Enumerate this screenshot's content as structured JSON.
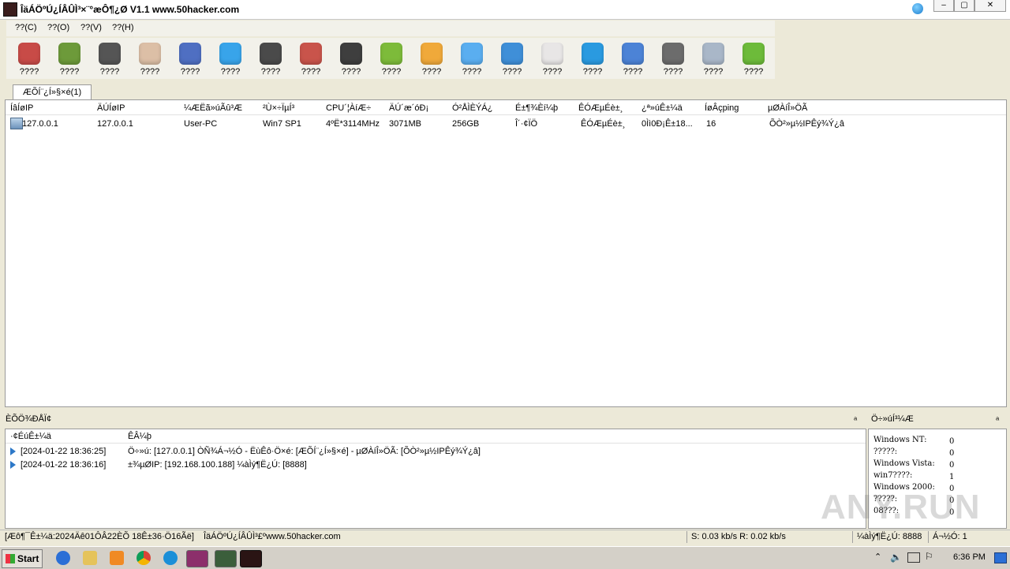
{
  "window": {
    "title": "ÎäÁÖºÚ¿ÍÂÛÌ³×¨°æÔ¶¿Ø V1.1 www.50hacker.com"
  },
  "menu": [
    "??(C)",
    "??(O)",
    "??(V)",
    "??(H)"
  ],
  "toolbar": [
    {
      "icon": "dictionary-icon",
      "label": "????",
      "color": "#c84b47"
    },
    {
      "icon": "drive-icon",
      "label": "????",
      "color": "#6d9a3a"
    },
    {
      "icon": "terminal-icon",
      "label": "????",
      "color": "#555555"
    },
    {
      "icon": "keypad-icon",
      "label": "????",
      "color": "#dcbfa6"
    },
    {
      "icon": "activity-icon",
      "label": "????",
      "color": "#4f6fc2"
    },
    {
      "icon": "appstore-icon",
      "label": "????",
      "color": "#38a4ea"
    },
    {
      "icon": "camera-icon",
      "label": "????",
      "color": "#4a4a4a"
    },
    {
      "icon": "microphone-icon",
      "label": "????",
      "color": "#c9544b"
    },
    {
      "icon": "clock-icon",
      "label": "????",
      "color": "#3e3e3e"
    },
    {
      "icon": "download-icon",
      "label": "????",
      "color": "#7dbb3a"
    },
    {
      "icon": "star-icon",
      "label": "????",
      "color": "#f0a93a"
    },
    {
      "icon": "cloud-icon",
      "label": "????",
      "color": "#5aaef0"
    },
    {
      "icon": "chat-icon",
      "label": "????",
      "color": "#3f8fd8"
    },
    {
      "icon": "calendar-icon",
      "label": "????",
      "color": "#e8e6e6"
    },
    {
      "icon": "skype-icon",
      "label": "????",
      "color": "#2a9ae0"
    },
    {
      "icon": "globe-icon",
      "label": "????",
      "color": "#4c83d6"
    },
    {
      "icon": "settings-icon",
      "label": "????",
      "color": "#6c6c6c"
    },
    {
      "icon": "checkbox-icon",
      "label": "????",
      "color": "#a9b7c8"
    },
    {
      "icon": "phone-icon",
      "label": "????",
      "color": "#6dbb3a"
    }
  ],
  "tab": {
    "label": "ÆÕÍ¨¿Í»§×é(1)"
  },
  "hosts": {
    "columns": [
      "ÍâÍøIP",
      "ÄÚÍøIP",
      "¼ÆËã»úÃû³Æ",
      "²Ù×÷ÏµÍ³",
      "CPU´¦ÀíÆ÷",
      "ÄÚ´æ´óÐ¡",
      "Ó²ÅÌÈÝÁ¿",
      "É±¶¾Èí¼þ",
      "ÊÓÆµÉè±¸",
      "¿ª»úÊ±¼ä",
      "ÍøÂçping",
      "µØÀíÎ»ÖÃ"
    ],
    "rows": [
      [
        "127.0.0.1",
        "127.0.0.1",
        "User-PC",
        "Win7 SP1",
        "4ºË*3114MHz",
        "3071MB",
        "256GB",
        "Î´·¢ÏÖ",
        "ÊÓÆµÉè±¸",
        "0Ìì0Ð¡Ê±18...",
        "16",
        "ÕÒ²»µ½IPÊý¾Ý¿â"
      ]
    ]
  },
  "log_panel": {
    "title": "ÈÕÖ¾ÐÅÏ¢",
    "columns": [
      "·¢ÉúÊ±¼ä",
      "ÊÂ¼þ"
    ],
    "rows": [
      {
        "time": "[2024-01-22 18:36:25]",
        "event": "Ö÷»ú: [127.0.0.1] ÒÑ¾­Á¬½Ó - ËùÊô·Ö×é: [ÆÕÍ¨¿Í»§×é] - µØÀíÎ»ÖÃ: [ÕÒ²»µ½IPÊý¾Ý¿â]"
      },
      {
        "time": "[2024-01-22 18:36:16]",
        "event": "±¾µØIP: [192.168.100.188] ¼àÌý¶Ë¿Ú: [8888]"
      }
    ]
  },
  "stats_panel": {
    "title": "Ö÷»úÍ³¼Æ",
    "rows": [
      {
        "label": "Windows NT:",
        "value": "0"
      },
      {
        "label": "?????:",
        "value": "0"
      },
      {
        "label": "Windows Vista:",
        "value": "0"
      },
      {
        "label": "win7????:",
        "value": "1"
      },
      {
        "label": "Windows 2000:",
        "value": "0"
      },
      {
        "label": "?????:",
        "value": "0"
      },
      {
        "label": "08???:",
        "value": "0"
      }
    ]
  },
  "pins": [
    "ₐ",
    "ₐ"
  ],
  "watermark": "ANY.RUN",
  "status": {
    "launch": "[Æô¶¯Ê±¼ä:2024Äê01ÔÂ22ÈÕ 18Ê±36·Ö16Ãë]",
    "site": "ÎäÁÖºÚ¿ÍÂÛÌ³£ºwww.50hacker.com",
    "speed": "S: 0.03 kb/s R: 0.02 kb/s",
    "port": "¼àÌý¶Ë¿Ú: 8888",
    "online": "Á¬½Ó: 1"
  },
  "taskbar": {
    "start": "Start",
    "clock": "6:36 PM"
  }
}
